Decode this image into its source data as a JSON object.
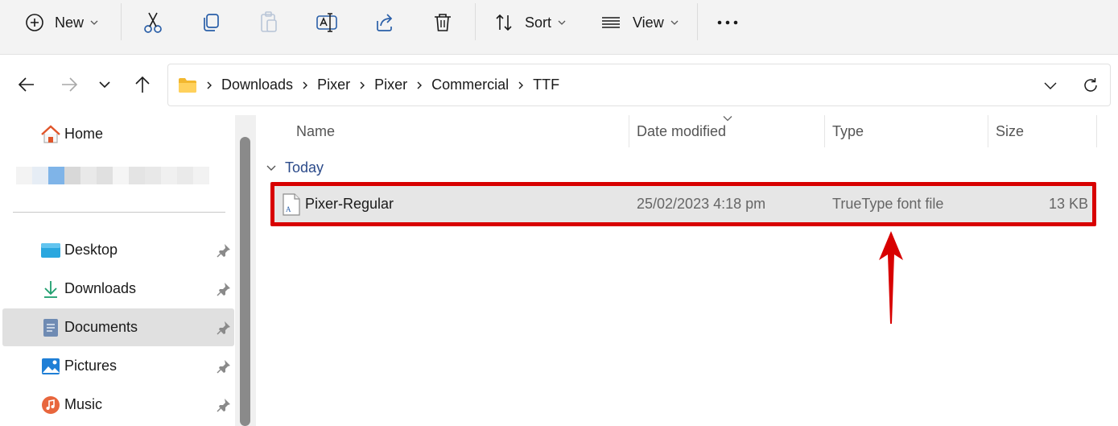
{
  "toolbar": {
    "new_label": "New",
    "sort_label": "Sort",
    "view_label": "View"
  },
  "breadcrumb": [
    "Downloads",
    "Pixer",
    "Pixer",
    "Commercial",
    "TTF"
  ],
  "sidebar": {
    "home": "Home",
    "items": [
      {
        "label": "Desktop"
      },
      {
        "label": "Downloads"
      },
      {
        "label": "Documents"
      },
      {
        "label": "Pictures"
      },
      {
        "label": "Music"
      }
    ]
  },
  "columns": {
    "name": "Name",
    "date": "Date modified",
    "type": "Type",
    "size": "Size"
  },
  "group": "Today",
  "files": [
    {
      "name": "Pixer-Regular",
      "date": "25/02/2023 4:18 pm",
      "type": "TrueType font file",
      "size": "13 KB"
    }
  ],
  "colors": {
    "highlight": "#d80000",
    "selected_row": "#e6e6e6",
    "group_text": "#2b4a8a"
  }
}
